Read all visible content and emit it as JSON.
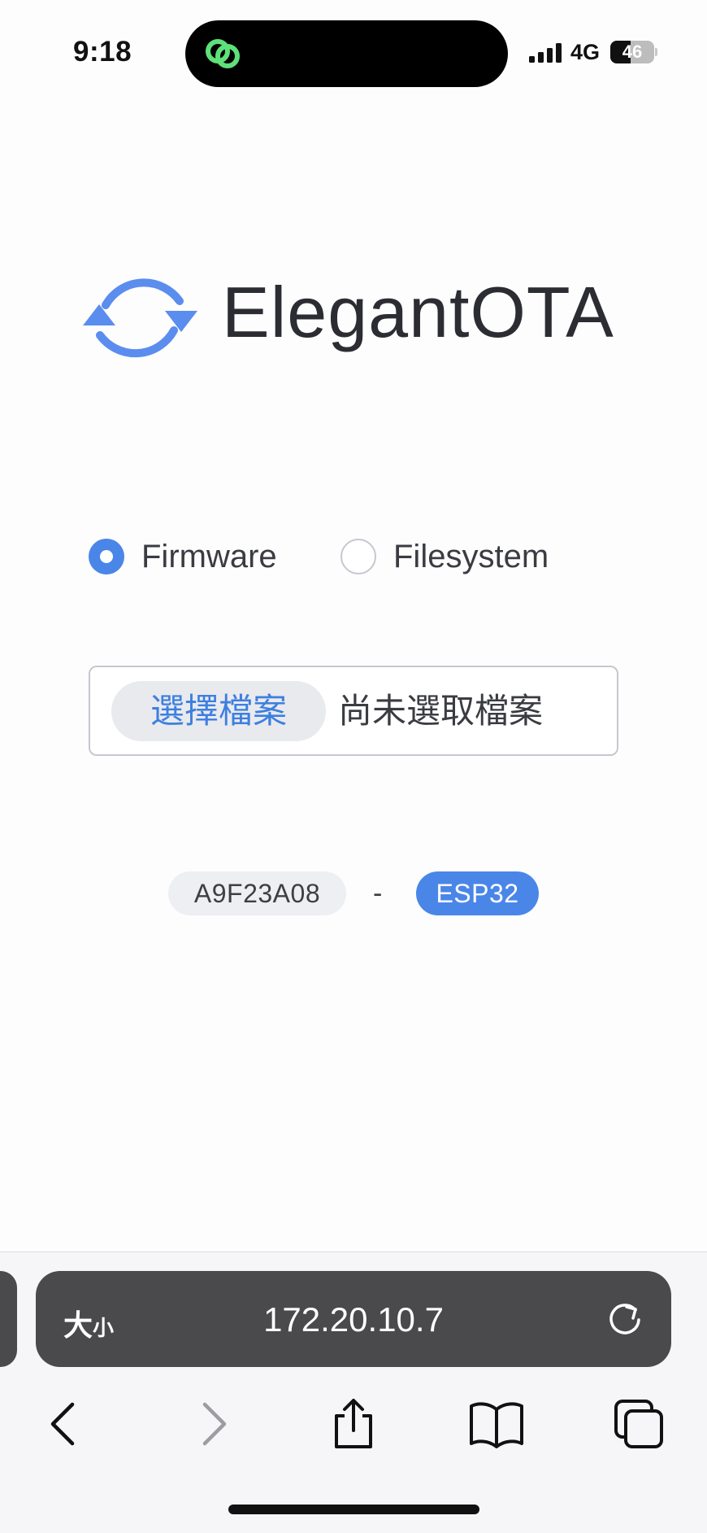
{
  "status_bar": {
    "time": "9:18",
    "network": "4G",
    "battery_level": "46",
    "app_icon": "link-rings-icon",
    "accent_color": "#5ee07a"
  },
  "logo": {
    "text": "ElegantOTA",
    "icon": "sync-arrows-icon",
    "icon_color": "#5b8def"
  },
  "update_type": {
    "options": [
      {
        "label": "Firmware",
        "checked": true
      },
      {
        "label": "Filesystem",
        "checked": false
      }
    ]
  },
  "file_picker": {
    "button_label": "選擇檔案",
    "status_text": "尚未選取檔案"
  },
  "device_info": {
    "hardware_id": "A9F23A08",
    "separator": "-",
    "chip": "ESP32",
    "chip_color": "#4a86e8"
  },
  "browser": {
    "text_size_label_large": "大",
    "text_size_label_small": "小",
    "url": "172.20.10.7",
    "icons": [
      "back-icon",
      "forward-icon",
      "share-icon",
      "bookmarks-icon",
      "tabs-icon",
      "reload-icon"
    ]
  }
}
